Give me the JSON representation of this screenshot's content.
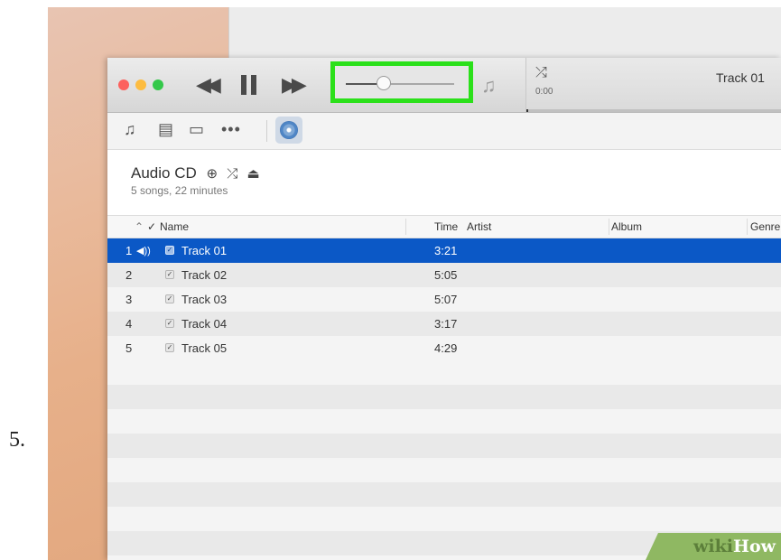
{
  "step_number": "5.",
  "titlebar": {
    "buttons": {
      "close": "#fc615d",
      "minimize": "#fdbc40",
      "zoom": "#34c84a"
    },
    "controls": {
      "previous_icon": "rewind-icon",
      "pause_icon": "pause-icon",
      "next_icon": "fast-forward-icon"
    },
    "volume": {
      "level": 0.35
    },
    "now_playing": {
      "shuffle_icon": "shuffle-icon",
      "elapsed": "0:00",
      "track": "Track 01"
    }
  },
  "toolbar": {
    "icons": [
      "music-note-icon",
      "film-icon",
      "tv-icon",
      "more-icon",
      "audio-cd-icon"
    ]
  },
  "source": {
    "title": "Audio CD",
    "subtitle": "5 songs, 22 minutes",
    "icons": [
      "add-icon",
      "shuffle-icon",
      "eject-icon"
    ]
  },
  "table": {
    "columns": {
      "check": "✓",
      "name": "Name",
      "time": "Time",
      "artist": "Artist",
      "album": "Album",
      "genre": "Genre"
    },
    "rows": [
      {
        "index": "1",
        "name": "Track 01",
        "time": "3:21",
        "playing": true
      },
      {
        "index": "2",
        "name": "Track 02",
        "time": "5:05",
        "playing": false
      },
      {
        "index": "3",
        "name": "Track 03",
        "time": "5:07",
        "playing": false
      },
      {
        "index": "4",
        "name": "Track 04",
        "time": "3:17",
        "playing": false
      },
      {
        "index": "5",
        "name": "Track 05",
        "time": "4:29",
        "playing": false
      }
    ]
  },
  "watermark": {
    "part1": "wiki",
    "part2": "How"
  },
  "colors": {
    "highlight": "#2be01a",
    "selection": "#0b58c6",
    "watermark_bg": "#8fb862"
  }
}
